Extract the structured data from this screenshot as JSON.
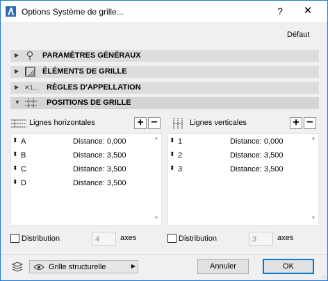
{
  "window": {
    "title": "Options Système de grille...",
    "help_label": "?",
    "close_label": "✕",
    "accent": "#1e78d4"
  },
  "defaut_label": "Défaut",
  "sections": [
    {
      "label": "PARAMÈTRES GÉNÉRAUX",
      "icon": "pin-icon",
      "expanded": false
    },
    {
      "label": "ÉLÉMENTS DE GRILLE",
      "icon": "grid-element-icon",
      "expanded": false
    },
    {
      "label": "RÈGLES D'APPELLATION",
      "icon": "naming-icon",
      "icon_text": "✕1...",
      "expanded": false
    },
    {
      "label": "POSITIONS DE GRILLE",
      "icon": "grid-position-icon",
      "expanded": true
    }
  ],
  "horizontal": {
    "title": "Lignes horizontales",
    "add": "+",
    "remove": "−",
    "rows": [
      {
        "name": "A",
        "distance": "Distance: 0,000"
      },
      {
        "name": "B",
        "distance": "Distance: 3,500"
      },
      {
        "name": "C",
        "distance": "Distance: 3,500"
      },
      {
        "name": "D",
        "distance": "Distance: 3,500"
      }
    ],
    "distribution_label": "Distribution",
    "distribution_checked": false,
    "axes_value": "4",
    "axes_label": "axes"
  },
  "vertical": {
    "title": "Lignes verticales",
    "add": "+",
    "remove": "−",
    "rows": [
      {
        "name": "1",
        "distance": "Distance: 0,000"
      },
      {
        "name": "2",
        "distance": "Distance: 3,500"
      },
      {
        "name": "3",
        "distance": "Distance: 3,500"
      }
    ],
    "distribution_label": "Distribution",
    "distribution_checked": false,
    "axes_value": "3",
    "axes_label": "axes"
  },
  "footer": {
    "layer_dropdown": "Grille structurelle",
    "cancel_label": "Annuler",
    "ok_label": "OK"
  }
}
